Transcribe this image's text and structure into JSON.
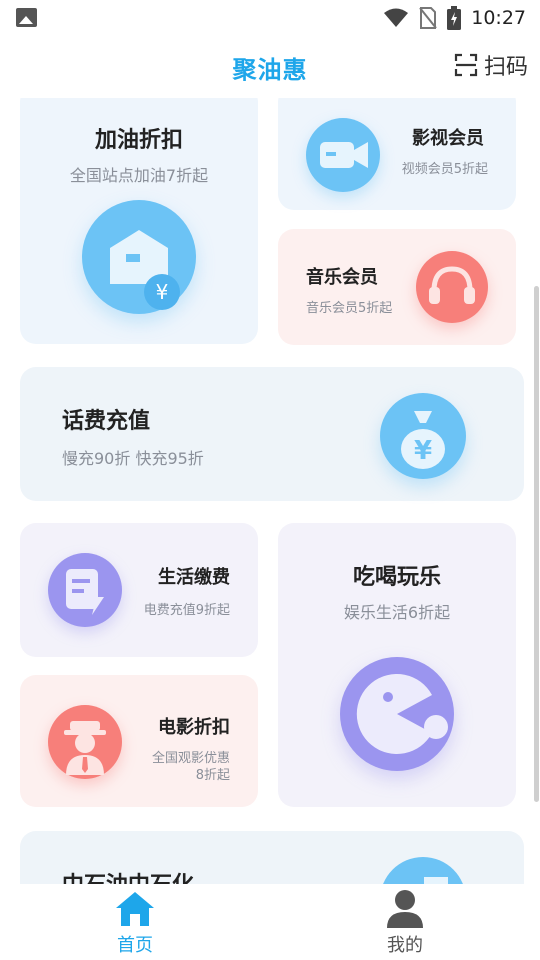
{
  "status_bar": {
    "time": "10:27"
  },
  "header": {
    "title": "聚油惠",
    "scan_label": "扫码"
  },
  "cards": {
    "fuel": {
      "title": "加油折扣",
      "subtitle": "全国站点加油7折起"
    },
    "video": {
      "title": "影视会员",
      "subtitle": "视频会员5折起"
    },
    "music": {
      "title": "音乐会员",
      "subtitle": "音乐会员5折起"
    },
    "phone": {
      "title": "话费充值",
      "subtitle": "慢充90折 快充95折"
    },
    "bills": {
      "title": "生活缴费",
      "subtitle": "电费充值9折起"
    },
    "fun": {
      "title": "吃喝玩乐",
      "subtitle": "娱乐生活6折起"
    },
    "movie": {
      "title": "电影折扣",
      "subtitle_line1": "全国观影优惠",
      "subtitle_line2": "8折起"
    },
    "sinopec": {
      "title": "中石油中石化"
    }
  },
  "nav": {
    "home_label": "首页",
    "mine_label": "我的"
  },
  "colors": {
    "accent": "#1ea6ea",
    "nav_inactive": "#555555"
  },
  "icons": {
    "fuel": "fuel-station-icon",
    "video": "video-camera-icon",
    "music": "headphones-icon",
    "phone": "money-bag-icon",
    "bills": "bill-document-icon",
    "fun": "pacman-icon",
    "movie": "person-hat-icon"
  }
}
